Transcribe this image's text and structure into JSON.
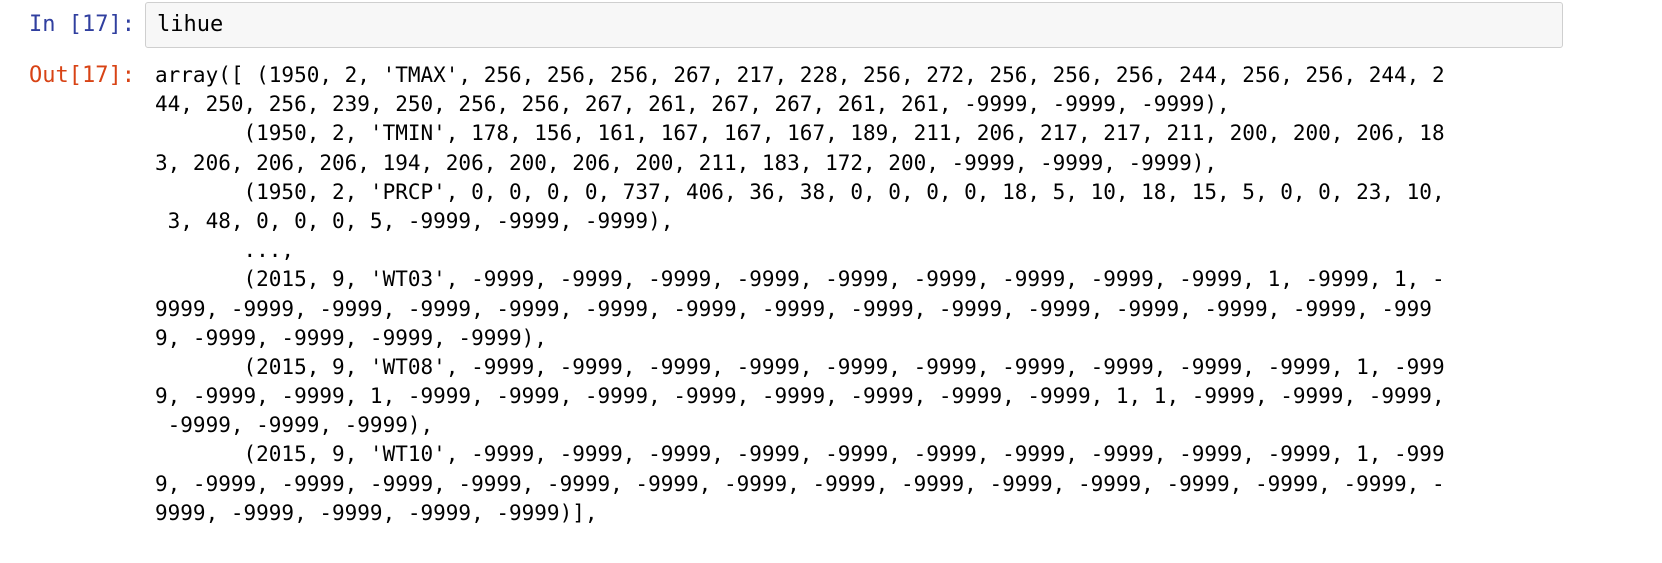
{
  "input_cell": {
    "prompt": "In [17]:",
    "code": "lihue"
  },
  "output_cell": {
    "prompt": "Out[17]:",
    "lines": [
      "array([ (1950, 2, 'TMAX', 256, 256, 256, 267, 217, 228, 256, 272, 256, 256, 256, 244, 256, 256, 244, 2",
      "44, 250, 256, 239, 250, 256, 256, 267, 261, 267, 267, 261, 261, -9999, -9999, -9999),",
      "       (1950, 2, 'TMIN', 178, 156, 161, 167, 167, 167, 189, 211, 206, 217, 217, 211, 200, 200, 206, 18",
      "3, 206, 206, 206, 194, 206, 200, 206, 200, 211, 183, 172, 200, -9999, -9999, -9999),",
      "       (1950, 2, 'PRCP', 0, 0, 0, 0, 737, 406, 36, 38, 0, 0, 0, 0, 18, 5, 10, 18, 15, 5, 0, 0, 23, 10,",
      " 3, 48, 0, 0, 0, 5, -9999, -9999, -9999),",
      "       ...,",
      "       (2015, 9, 'WT03', -9999, -9999, -9999, -9999, -9999, -9999, -9999, -9999, -9999, 1, -9999, 1, -",
      "9999, -9999, -9999, -9999, -9999, -9999, -9999, -9999, -9999, -9999, -9999, -9999, -9999, -9999, -999",
      "9, -9999, -9999, -9999, -9999),",
      "       (2015, 9, 'WT08', -9999, -9999, -9999, -9999, -9999, -9999, -9999, -9999, -9999, -9999, 1, -999",
      "9, -9999, -9999, 1, -9999, -9999, -9999, -9999, -9999, -9999, -9999, -9999, 1, 1, -9999, -9999, -9999,",
      " -9999, -9999, -9999),",
      "       (2015, 9, 'WT10', -9999, -9999, -9999, -9999, -9999, -9999, -9999, -9999, -9999, -9999, 1, -999",
      "9, -9999, -9999, -9999, -9999, -9999, -9999, -9999, -9999, -9999, -9999, -9999, -9999, -9999, -9999, -",
      "9999, -9999, -9999, -9999, -9999)],"
    ]
  },
  "colors": {
    "in_prompt": "#303f9f",
    "out_prompt": "#d84315",
    "input_background": "#f7f7f7",
    "input_border": "#cfcfcf"
  }
}
